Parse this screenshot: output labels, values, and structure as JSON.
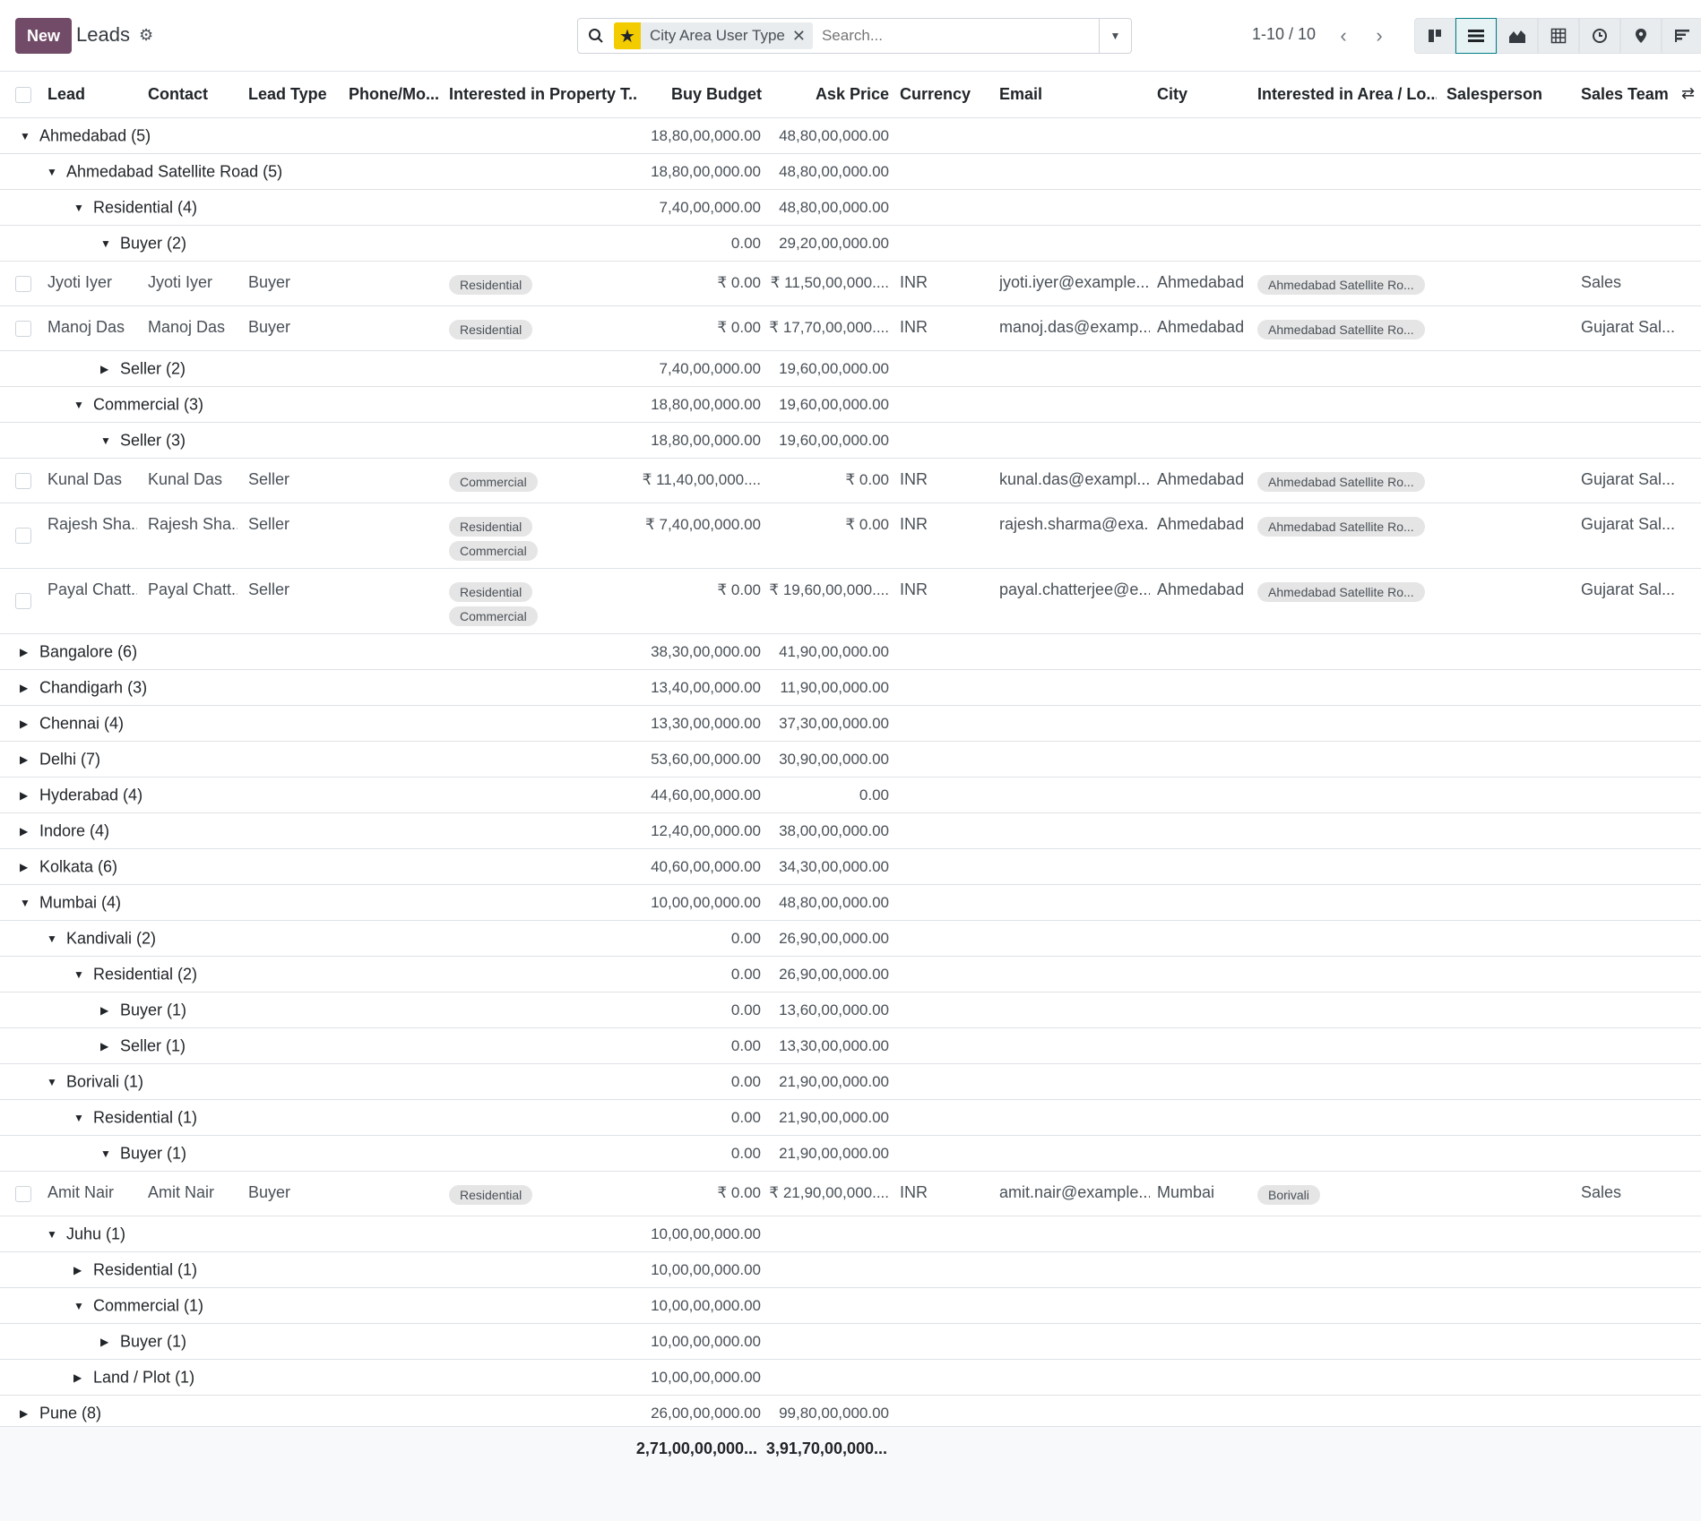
{
  "control_panel": {
    "new_label": "New",
    "title": "Leads",
    "search": {
      "facet": "City Area User Type",
      "placeholder": "Search..."
    },
    "pager": "1-10 / 10"
  },
  "columns": [
    "Lead",
    "Contact",
    "Lead Type",
    "Phone/Mo...",
    "Interested in Property T...",
    "Buy Budget",
    "Ask Price",
    "Currency",
    "Email",
    "City",
    "Interested in Area / Lo...",
    "Salesperson",
    "Sales Team"
  ],
  "rows": [
    {
      "kind": "group",
      "level": 0,
      "open": true,
      "label": "Ahmedabad (5)",
      "buy": "18,80,00,000.00",
      "ask": "48,80,00,000.00"
    },
    {
      "kind": "group",
      "level": 1,
      "open": true,
      "label": "Ahmedabad Satellite Road (5)",
      "buy": "18,80,00,000.00",
      "ask": "48,80,00,000.00"
    },
    {
      "kind": "group",
      "level": 2,
      "open": true,
      "label": "Residential (4)",
      "buy": "7,40,00,000.00",
      "ask": "48,80,00,000.00"
    },
    {
      "kind": "group",
      "level": 3,
      "open": true,
      "label": "Buyer (2)",
      "buy": "0.00",
      "ask": "29,20,00,000.00"
    },
    {
      "kind": "record",
      "lead": "Jyoti Iyer",
      "contact": "Jyoti Iyer",
      "type": "Buyer",
      "tags": [
        "Residential"
      ],
      "buy": "₹ 0.00",
      "ask": "₹ 11,50,00,000....",
      "currency": "INR",
      "email": "jyoti.iyer@example....",
      "city": "Ahmedabad",
      "area": "Ahmedabad Satellite Ro...",
      "team": "Sales"
    },
    {
      "kind": "record",
      "lead": "Manoj Das",
      "contact": "Manoj Das",
      "type": "Buyer",
      "tags": [
        "Residential"
      ],
      "buy": "₹ 0.00",
      "ask": "₹ 17,70,00,000....",
      "currency": "INR",
      "email": "manoj.das@examp...",
      "city": "Ahmedabad",
      "area": "Ahmedabad Satellite Ro...",
      "team": "Gujarat Sal..."
    },
    {
      "kind": "group",
      "level": 3,
      "open": false,
      "label": "Seller (2)",
      "buy": "7,40,00,000.00",
      "ask": "19,60,00,000.00"
    },
    {
      "kind": "group",
      "level": 2,
      "open": true,
      "label": "Commercial (3)",
      "buy": "18,80,00,000.00",
      "ask": "19,60,00,000.00"
    },
    {
      "kind": "group",
      "level": 3,
      "open": true,
      "label": "Seller (3)",
      "buy": "18,80,00,000.00",
      "ask": "19,60,00,000.00"
    },
    {
      "kind": "record",
      "lead": "Kunal Das",
      "contact": "Kunal Das",
      "type": "Seller",
      "tags": [
        "Commercial"
      ],
      "buy": "₹ 11,40,00,000....",
      "ask": "₹ 0.00",
      "currency": "INR",
      "email": "kunal.das@exampl...",
      "city": "Ahmedabad",
      "area": "Ahmedabad Satellite Ro...",
      "team": "Gujarat Sal..."
    },
    {
      "kind": "record",
      "lead": "Rajesh Sha...",
      "contact": "Rajesh Sha...",
      "type": "Seller",
      "tags": [
        "Residential",
        "Commercial"
      ],
      "buy": "₹ 7,40,00,000.00",
      "ask": "₹ 0.00",
      "currency": "INR",
      "email": "rajesh.sharma@exa...",
      "city": "Ahmedabad",
      "area": "Ahmedabad Satellite Ro...",
      "team": "Gujarat Sal..."
    },
    {
      "kind": "record",
      "lead": "Payal Chatt...",
      "contact": "Payal Chatt...",
      "type": "Seller",
      "tags": [
        "Residential",
        "Commercial"
      ],
      "buy": "₹ 0.00",
      "ask": "₹ 19,60,00,000....",
      "currency": "INR",
      "email": "payal.chatterjee@e...",
      "city": "Ahmedabad",
      "area": "Ahmedabad Satellite Ro...",
      "team": "Gujarat Sal..."
    },
    {
      "kind": "group",
      "level": 0,
      "open": false,
      "label": "Bangalore (6)",
      "buy": "38,30,00,000.00",
      "ask": "41,90,00,000.00"
    },
    {
      "kind": "group",
      "level": 0,
      "open": false,
      "label": "Chandigarh (3)",
      "buy": "13,40,00,000.00",
      "ask": "11,90,00,000.00"
    },
    {
      "kind": "group",
      "level": 0,
      "open": false,
      "label": "Chennai (4)",
      "buy": "13,30,00,000.00",
      "ask": "37,30,00,000.00"
    },
    {
      "kind": "group",
      "level": 0,
      "open": false,
      "label": "Delhi (7)",
      "buy": "53,60,00,000.00",
      "ask": "30,90,00,000.00"
    },
    {
      "kind": "group",
      "level": 0,
      "open": false,
      "label": "Hyderabad (4)",
      "buy": "44,60,00,000.00",
      "ask": "0.00"
    },
    {
      "kind": "group",
      "level": 0,
      "open": false,
      "label": "Indore (4)",
      "buy": "12,40,00,000.00",
      "ask": "38,00,00,000.00"
    },
    {
      "kind": "group",
      "level": 0,
      "open": false,
      "label": "Kolkata (6)",
      "buy": "40,60,00,000.00",
      "ask": "34,30,00,000.00"
    },
    {
      "kind": "group",
      "level": 0,
      "open": true,
      "label": "Mumbai (4)",
      "buy": "10,00,00,000.00",
      "ask": "48,80,00,000.00"
    },
    {
      "kind": "group",
      "level": 1,
      "open": true,
      "label": "Kandivali (2)",
      "buy": "0.00",
      "ask": "26,90,00,000.00"
    },
    {
      "kind": "group",
      "level": 2,
      "open": true,
      "label": "Residential (2)",
      "buy": "0.00",
      "ask": "26,90,00,000.00"
    },
    {
      "kind": "group",
      "level": 3,
      "open": false,
      "label": "Buyer (1)",
      "buy": "0.00",
      "ask": "13,60,00,000.00"
    },
    {
      "kind": "group",
      "level": 3,
      "open": false,
      "label": "Seller (1)",
      "buy": "0.00",
      "ask": "13,30,00,000.00"
    },
    {
      "kind": "group",
      "level": 1,
      "open": true,
      "label": "Borivali (1)",
      "buy": "0.00",
      "ask": "21,90,00,000.00"
    },
    {
      "kind": "group",
      "level": 2,
      "open": true,
      "label": "Residential (1)",
      "buy": "0.00",
      "ask": "21,90,00,000.00"
    },
    {
      "kind": "group",
      "level": 3,
      "open": true,
      "label": "Buyer (1)",
      "buy": "0.00",
      "ask": "21,90,00,000.00"
    },
    {
      "kind": "record",
      "lead": "Amit Nair",
      "contact": "Amit Nair",
      "type": "Buyer",
      "tags": [
        "Residential"
      ],
      "buy": "₹ 0.00",
      "ask": "₹ 21,90,00,000....",
      "currency": "INR",
      "email": "amit.nair@example....",
      "city": "Mumbai",
      "area": "Borivali",
      "team": "Sales"
    },
    {
      "kind": "group",
      "level": 1,
      "open": true,
      "label": "Juhu (1)",
      "buy": "10,00,00,000.00",
      "ask": ""
    },
    {
      "kind": "group",
      "level": 2,
      "open": false,
      "label": "Residential (1)",
      "buy": "10,00,00,000.00",
      "ask": ""
    },
    {
      "kind": "group",
      "level": 2,
      "open": true,
      "label": "Commercial (1)",
      "buy": "10,00,00,000.00",
      "ask": ""
    },
    {
      "kind": "group",
      "level": 3,
      "open": false,
      "label": "Buyer (1)",
      "buy": "10,00,00,000.00",
      "ask": ""
    },
    {
      "kind": "group",
      "level": 2,
      "open": false,
      "label": "Land / Plot (1)",
      "buy": "10,00,00,000.00",
      "ask": ""
    },
    {
      "kind": "group",
      "level": 0,
      "open": false,
      "label": "Pune (8)",
      "buy": "26,00,00,000.00",
      "ask": "99,80,00,000.00"
    }
  ],
  "totals": {
    "buy": "2,71,00,00,000...",
    "ask": "3,91,70,00,000..."
  }
}
